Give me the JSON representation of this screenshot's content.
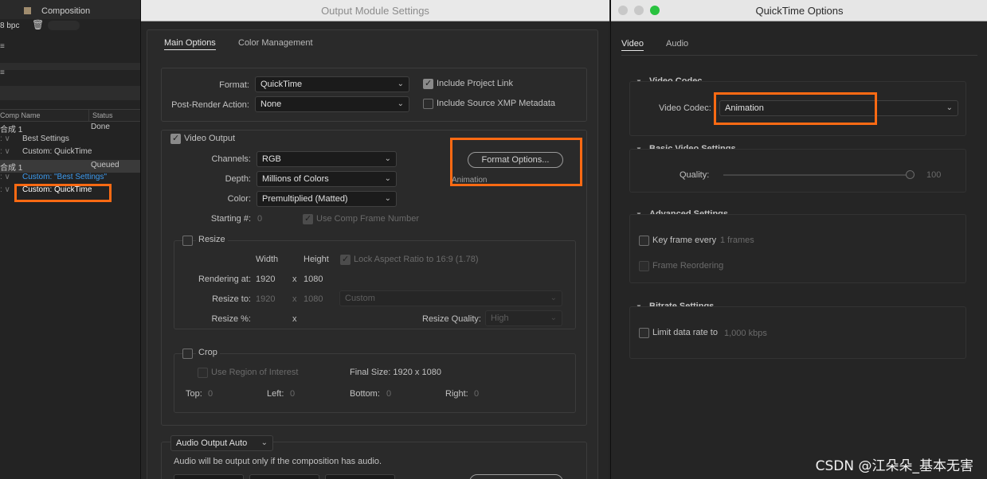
{
  "left_panel": {
    "composition_label": "Composition",
    "bpc": "8 bpc",
    "trash_icon": "trash-icon",
    "col_comp_name": "Comp Name",
    "col_status": "Status",
    "rows": [
      {
        "name": "合成 1",
        "status": "Done"
      },
      {
        "name": "Best Settings",
        "status": ""
      },
      {
        "name": "Custom: QuickTime",
        "status": ""
      },
      {
        "name": "合成 1",
        "status": "Queued"
      },
      {
        "name": "Custom: \"Best Settings\"",
        "status": ""
      },
      {
        "name": "Custom: QuickTime",
        "status": ""
      }
    ]
  },
  "output_module": {
    "title": "Output Module Settings",
    "tabs": [
      "Main Options",
      "Color Management"
    ],
    "format_label": "Format:",
    "format_value": "QuickTime",
    "post_render_label": "Post-Render Action:",
    "post_render_value": "None",
    "include_project_link": "Include Project Link",
    "include_xmp": "Include Source XMP Metadata",
    "video_output": "Video Output",
    "channels_label": "Channels:",
    "channels_value": "RGB",
    "depth_label": "Depth:",
    "depth_value": "Millions of Colors",
    "color_label": "Color:",
    "color_value": "Premultiplied (Matted)",
    "starting_label": "Starting #:",
    "starting_value": "0",
    "use_comp_frame": "Use Comp Frame Number",
    "format_options_button": "Format Options...",
    "format_options_desc": "Animation",
    "resize": "Resize",
    "width_label": "Width",
    "height_label": "Height",
    "lock_aspect": "Lock Aspect Ratio to 16:9 (1.78)",
    "rendering_at_label": "Rendering at:",
    "rendering_w": "1920",
    "rendering_h": "1080",
    "resize_to_label": "Resize to:",
    "resize_to_w": "1920",
    "resize_to_h": "1080",
    "x_sep": "x",
    "resize_preset": "Custom",
    "resize_pct_label": "Resize %:",
    "resize_quality_label": "Resize Quality:",
    "resize_quality_value": "High",
    "crop": "Crop",
    "use_roi": "Use Region of Interest",
    "final_size": "Final Size: 1920 x 1080",
    "top_label": "Top:",
    "top_value": "0",
    "left_label": "Left:",
    "left_value": "0",
    "bottom_label": "Bottom:",
    "bottom_value": "0",
    "right_label": "Right:",
    "right_value": "0",
    "audio_output": "Audio Output Auto",
    "audio_note": "Audio will be output only if the composition has audio."
  },
  "quicktime": {
    "title": "QuickTime Options",
    "tabs": [
      "Video",
      "Audio"
    ],
    "video_codec_header": "Video Codec",
    "video_codec_label": "Video Codec:",
    "video_codec_value": "Animation",
    "basic_header": "Basic Video Settings",
    "quality_label": "Quality:",
    "quality_value": "100",
    "advanced_header": "Advanced Settings",
    "key_frame": "Key frame every",
    "key_frame_value": "1 frames",
    "frame_reorder": "Frame Reordering",
    "bitrate_header": "Bitrate Settings",
    "limit_rate": "Limit data rate to",
    "limit_rate_value": "1,000 kbps"
  },
  "watermark": "CSDN @江朵朵_基本无害",
  "colors": {
    "highlight": "#ff6a13",
    "link": "#3d9bf0"
  }
}
